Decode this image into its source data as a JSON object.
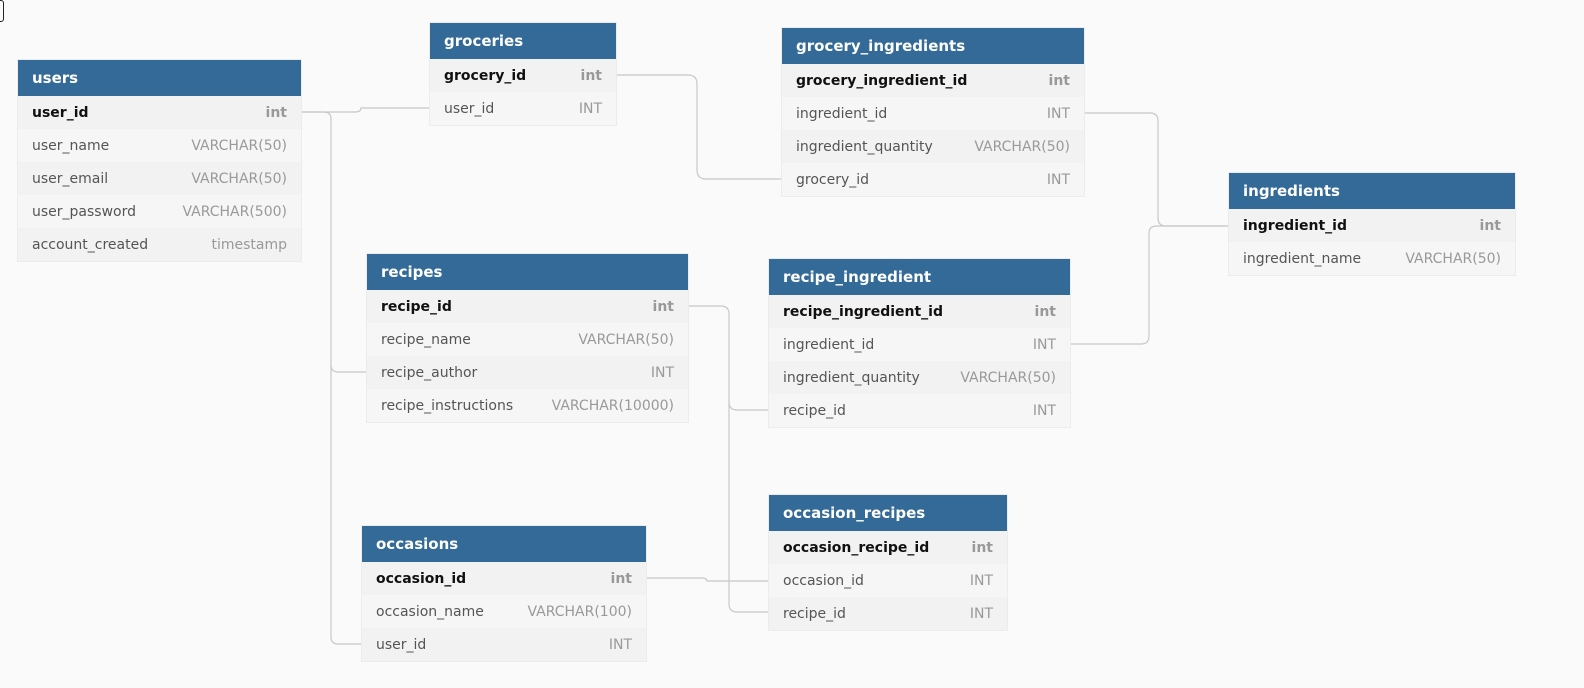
{
  "tables": {
    "users": {
      "title": "users",
      "columns": [
        {
          "name": "user_id",
          "type": "int"
        },
        {
          "name": "user_name",
          "type": "VARCHAR(50)"
        },
        {
          "name": "user_email",
          "type": "VARCHAR(50)"
        },
        {
          "name": "user_password",
          "type": "VARCHAR(500)"
        },
        {
          "name": "account_created",
          "type": "timestamp"
        }
      ]
    },
    "groceries": {
      "title": "groceries",
      "columns": [
        {
          "name": "grocery_id",
          "type": "int"
        },
        {
          "name": "user_id",
          "type": "INT"
        }
      ]
    },
    "grocery_ingredients": {
      "title": "grocery_ingredients",
      "columns": [
        {
          "name": "grocery_ingredient_id",
          "type": "int"
        },
        {
          "name": "ingredient_id",
          "type": "INT"
        },
        {
          "name": "ingredient_quantity",
          "type": "VARCHAR(50)"
        },
        {
          "name": "grocery_id",
          "type": "INT"
        }
      ]
    },
    "ingredients": {
      "title": "ingredients",
      "columns": [
        {
          "name": "ingredient_id",
          "type": "int"
        },
        {
          "name": "ingredient_name",
          "type": "VARCHAR(50)"
        }
      ]
    },
    "recipes": {
      "title": "recipes",
      "columns": [
        {
          "name": "recipe_id",
          "type": "int"
        },
        {
          "name": "recipe_name",
          "type": "VARCHAR(50)"
        },
        {
          "name": "recipe_author",
          "type": "INT"
        },
        {
          "name": "recipe_instructions",
          "type": "VARCHAR(10000)"
        }
      ]
    },
    "recipe_ingredient": {
      "title": "recipe_ingredient",
      "columns": [
        {
          "name": "recipe_ingredient_id",
          "type": "int"
        },
        {
          "name": "ingredient_id",
          "type": "INT"
        },
        {
          "name": "ingredient_quantity",
          "type": "VARCHAR(50)"
        },
        {
          "name": "recipe_id",
          "type": "INT"
        }
      ]
    },
    "occasions": {
      "title": "occasions",
      "columns": [
        {
          "name": "occasion_id",
          "type": "int"
        },
        {
          "name": "occasion_name",
          "type": "VARCHAR(100)"
        },
        {
          "name": "user_id",
          "type": "INT"
        }
      ]
    },
    "occasion_recipes": {
      "title": "occasion_recipes",
      "columns": [
        {
          "name": "occasion_recipe_id",
          "type": "int"
        },
        {
          "name": "occasion_id",
          "type": "INT"
        },
        {
          "name": "recipe_id",
          "type": "INT"
        }
      ]
    }
  },
  "colors": {
    "header": "#336a97",
    "connector": "#c8c8c8",
    "background": "#fafafa"
  }
}
